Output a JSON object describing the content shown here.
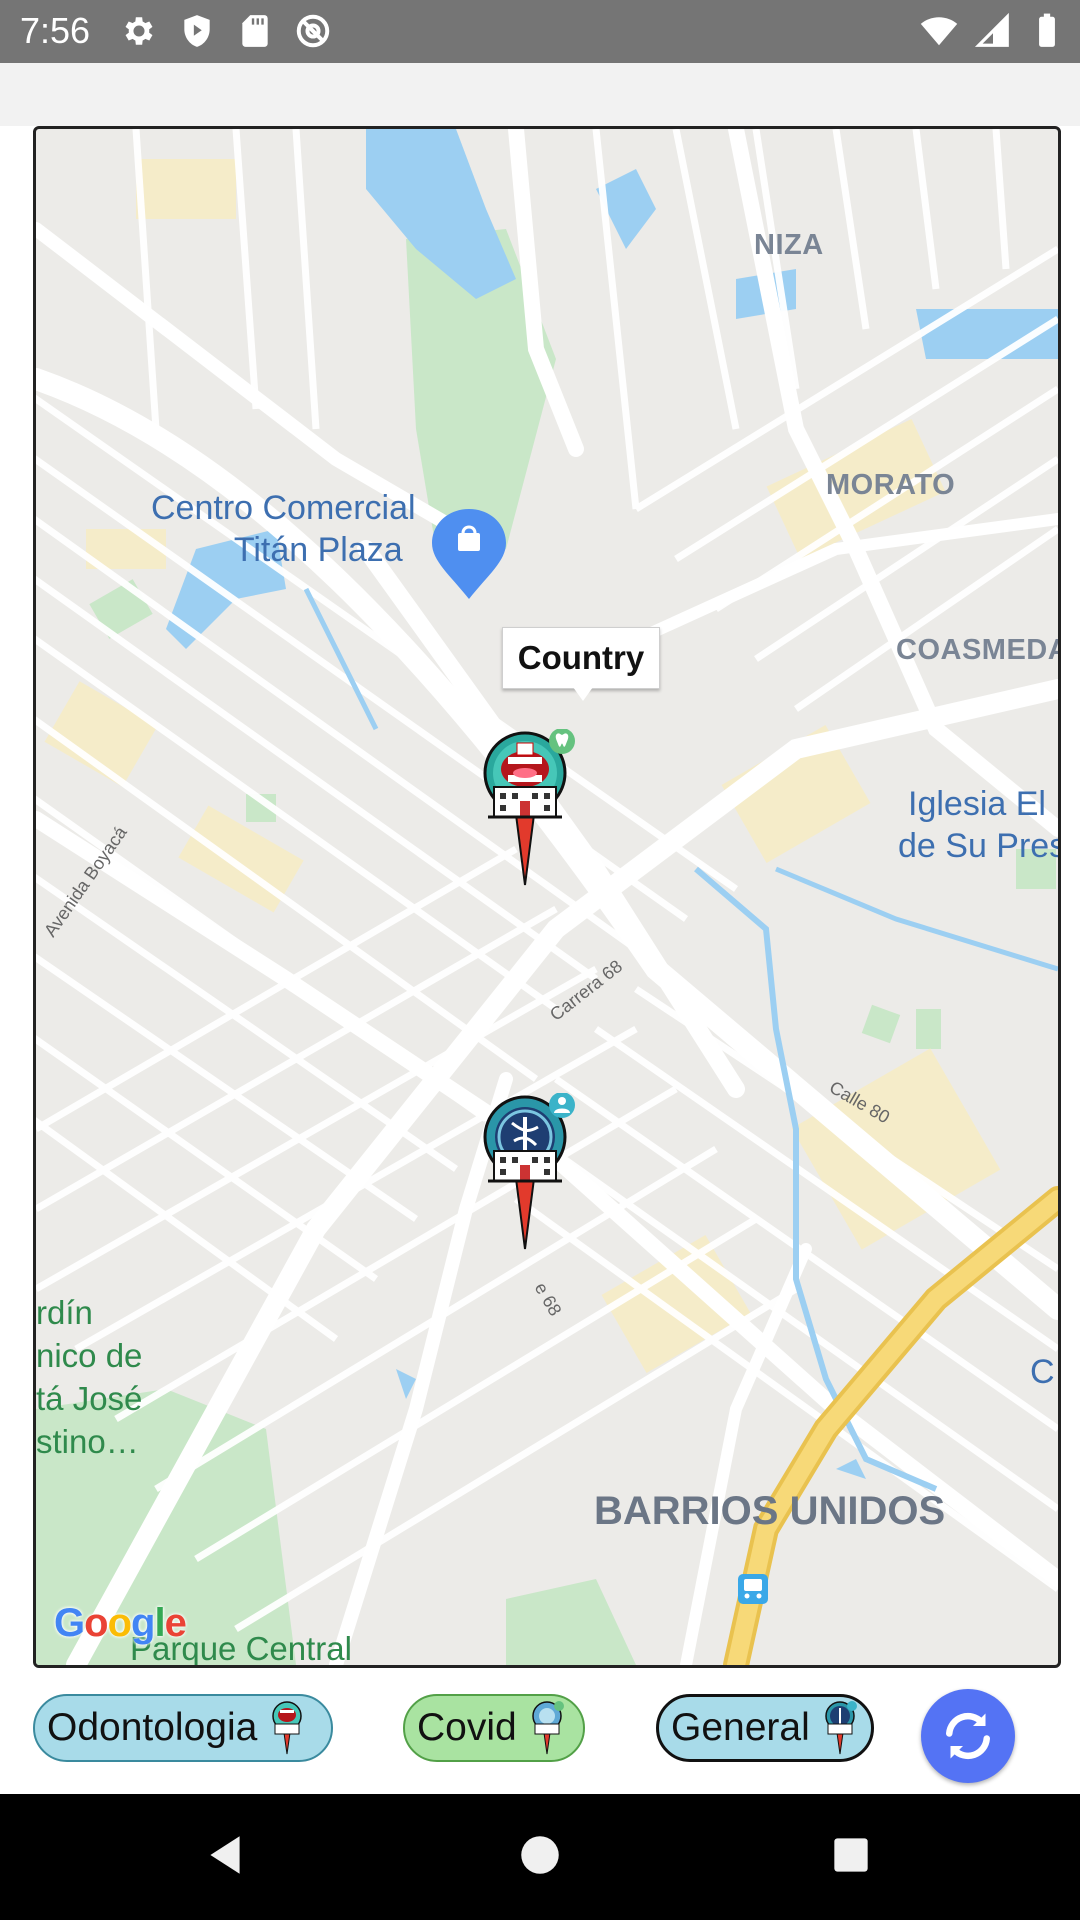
{
  "status_bar": {
    "time": "7:56",
    "left_icons": [
      "settings-icon",
      "shield-play-icon",
      "sd-card-icon",
      "no-tracking-icon"
    ],
    "right_icons": [
      "wifi-icon",
      "signal-icon",
      "battery-icon"
    ]
  },
  "map": {
    "labels": {
      "niza": "NIZA",
      "morato": "MORATO",
      "coasmedas": "COASMEDA",
      "mall_line1": "Centro Comercial",
      "mall_line2": "Titán Plaza",
      "church_line1": "Iglesia El I",
      "church_line2": "de Su Pres",
      "garden_line1": "rdín",
      "garden_line2": "nico de",
      "garden_line3": "tá José",
      "garden_line4": "stino…",
      "barrios_unidos": "BARRIOS UNIDOS",
      "parque_central": "Parque Central",
      "c_edge": "C",
      "avenida_boyaca": "Avenida Boyacá",
      "carrera_68": "Carrera 68",
      "carrera_68b": "e 68",
      "calle_80": "Calle 80"
    },
    "callout": "Country",
    "markers": [
      {
        "type": "dental",
        "name": "dental-clinic-marker"
      },
      {
        "type": "general",
        "name": "general-clinic-marker"
      }
    ],
    "attribution": "Google",
    "colors": {
      "roads": "#ffffff",
      "water": "#9fd3f5",
      "park": "#c5e8c8",
      "highway": "#f5d36b"
    }
  },
  "filters": {
    "odontologia": "Odontologia",
    "covid": "Covid",
    "general": "General",
    "refresh_icon": "refresh-icon"
  },
  "nav": [
    "back-icon",
    "home-icon",
    "recents-icon"
  ]
}
